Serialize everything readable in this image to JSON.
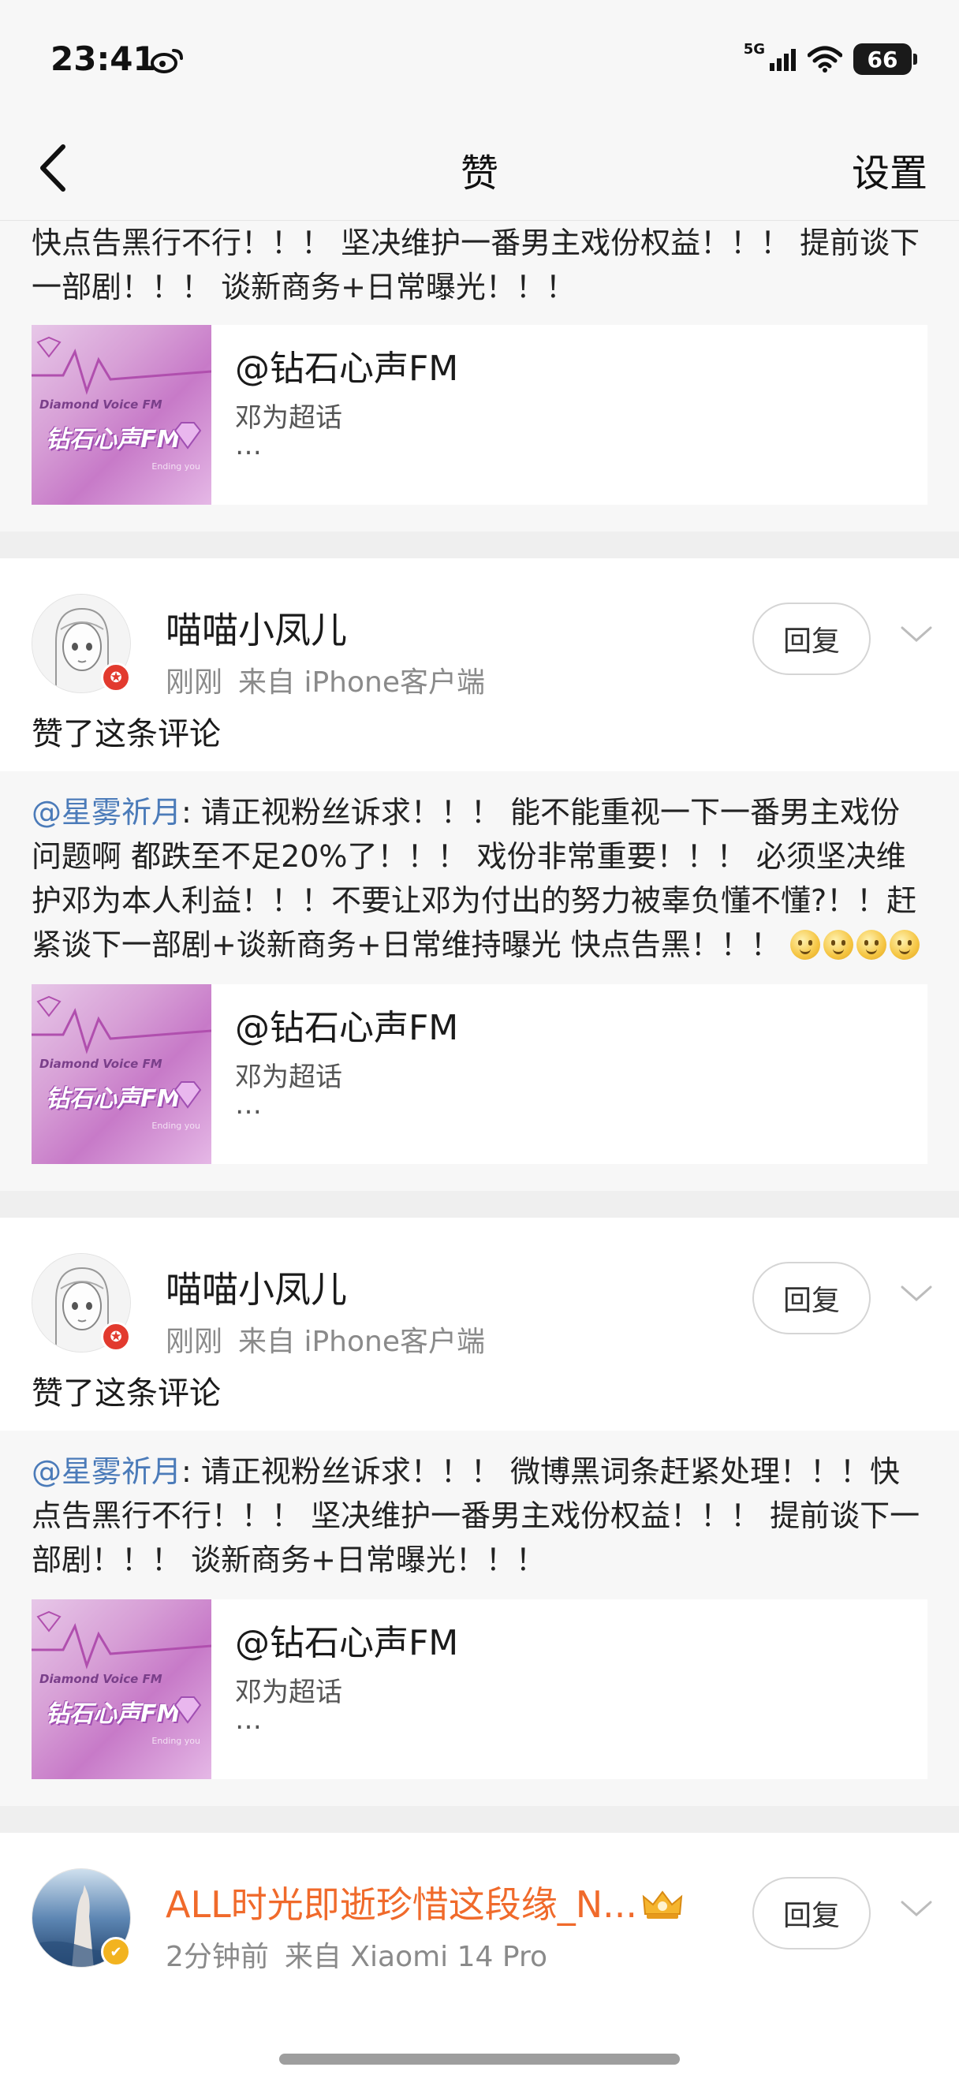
{
  "status_bar": {
    "time": "23:41",
    "network": "5G",
    "battery": "66"
  },
  "nav": {
    "title": "赞",
    "settings": "设置"
  },
  "top_fragment": {
    "text": "快点告黑行不行！！！ 坚决维护一番男主戏份权益！！！ 提前谈下一部剧！！！ 谈新商务+日常曝光！！！",
    "card": {
      "title": "@钻石心声FM",
      "subtitle": "邓为超话",
      "dots": "…"
    }
  },
  "thumb": {
    "en": "Diamond Voice FM",
    "cn": "钻石心声FM",
    "small": "Ending you"
  },
  "items": [
    {
      "user": "喵喵小凤儿",
      "time": "刚刚",
      "source": "来自 iPhone客户端",
      "reply": "回复",
      "action": "赞了这条评论",
      "quote_mention": "@星雾祈月",
      "quote_text": ": 请正视粉丝诉求！！！ 能不能重视一下一番男主戏份问题啊 都跌至不足20%了！！！ 戏份非常重要！！！ 必须坚决维护邓为本人利益！！！不要让邓为付出的努力被辜负懂不懂?！！赶紧谈下一部剧+谈新商务+日常维持曝光 快点告黑！！！ ",
      "card": {
        "title": "@钻石心声FM",
        "subtitle": "邓为超话",
        "dots": "…"
      }
    },
    {
      "user": "喵喵小凤儿",
      "time": "刚刚",
      "source": "来自 iPhone客户端",
      "reply": "回复",
      "action": "赞了这条评论",
      "quote_mention": "@星雾祈月",
      "quote_text": ": 请正视粉丝诉求！！！ 微博黑词条赶紧处理！！！快点告黑行不行！！！ 坚决维护一番男主戏份权益！！！ 提前谈下一部剧！！！ 谈新商务+日常曝光！！！",
      "card": {
        "title": "@钻石心声FM",
        "subtitle": "邓为超话",
        "dots": "…"
      }
    },
    {
      "user": "ALL时光即逝珍惜这段缘_N...",
      "time": "2分钟前",
      "source": "来自 Xiaomi 14 Pro",
      "reply": "回复"
    }
  ]
}
